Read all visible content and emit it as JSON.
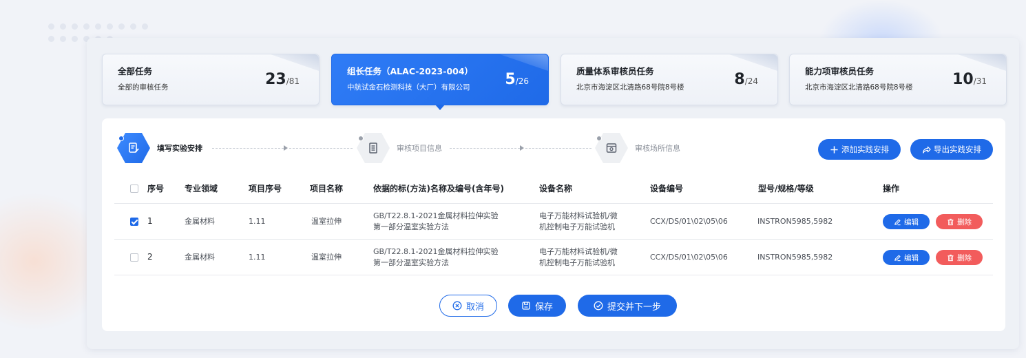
{
  "cards": [
    {
      "title": "全部任务",
      "subtitle": "全部的审核任务",
      "count": "23",
      "total": "/81",
      "active": false
    },
    {
      "title": "组长任务（ALAC-2023-004）",
      "subtitle": "中航试金石检测科技（大厂）有限公司",
      "count": "5",
      "total": "/26",
      "active": true
    },
    {
      "title": "质量体系审核员任务",
      "subtitle": "北京市海淀区北清路68号院8号楼",
      "count": "8",
      "total": "/24",
      "active": false
    },
    {
      "title": "能力项审核员任务",
      "subtitle": "北京市海淀区北清路68号院8号楼",
      "count": "10",
      "total": "/31",
      "active": false
    }
  ],
  "steps": [
    {
      "label": "填写实验安排",
      "icon": "edit-document-icon",
      "active": true
    },
    {
      "label": "审核项目信息",
      "icon": "document-list-icon",
      "active": false
    },
    {
      "label": "审核场所信息",
      "icon": "location-box-icon",
      "active": false
    }
  ],
  "actions": {
    "add_label": "添加实践安排",
    "export_label": "导出实践安排"
  },
  "table": {
    "columns": [
      "序号",
      "专业领域",
      "项目序号",
      "项目名称",
      "依据的标(方法)名称及编号(含年号)",
      "设备名称",
      "设备编号",
      "型号/规格/等级",
      "操作"
    ],
    "rows": [
      {
        "checked": true,
        "seq": "1",
        "field": "金属材料",
        "item_no": "1.11",
        "item_name": "温室拉伸",
        "standard_line1": "GB/T22.8.1-2021金属材料拉伸实验",
        "standard_line2": "第一部分温室实验方法",
        "equip_line1": "电子万能材料试验机/微",
        "equip_line2": "机控制电子万能试验机",
        "equip_no": "CCX/DS/01\\02\\05\\06",
        "model": "INSTRON5985,5982",
        "edit_label": "编辑",
        "delete_label": "删除"
      },
      {
        "checked": false,
        "seq": "2",
        "field": "金属材料",
        "item_no": "1.11",
        "item_name": "温室拉伸",
        "standard_line1": "GB/T22.8.1-2021金属材料拉伸实验",
        "standard_line2": "第一部分温室实验方法",
        "equip_line1": "电子万能材料试验机/微",
        "equip_line2": "机控制电子万能试验机",
        "equip_no": "CCX/DS/01\\02\\05\\06",
        "model": "INSTRON5985,5982",
        "edit_label": "编辑",
        "delete_label": "删除"
      }
    ]
  },
  "footer": {
    "cancel_label": "取消",
    "save_label": "保存",
    "submit_label": "提交并下一步"
  },
  "colors": {
    "primary": "#1f6ae8",
    "danger": "#f25c5c"
  }
}
